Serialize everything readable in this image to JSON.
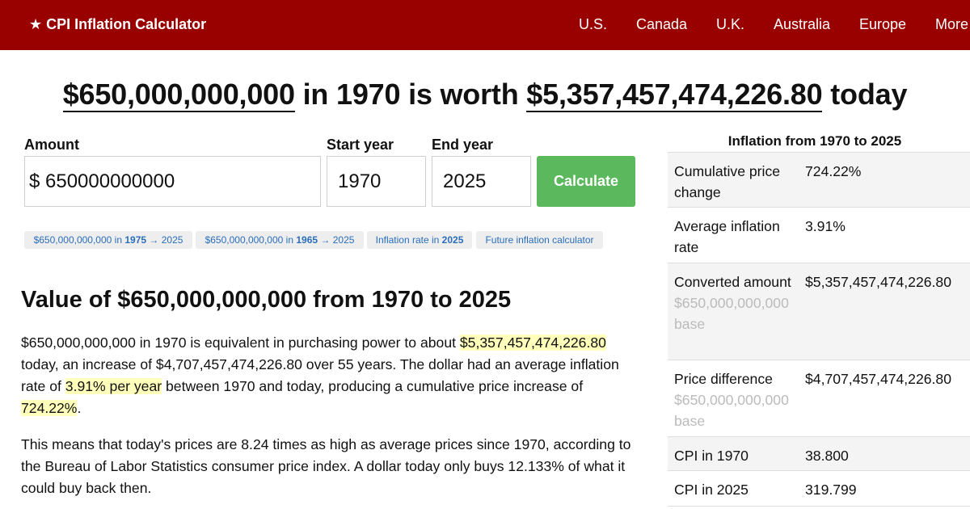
{
  "header": {
    "brand": "★ CPI Inflation Calculator",
    "nav": [
      "U.S.",
      "Canada",
      "U.K.",
      "Australia",
      "Europe",
      "More"
    ]
  },
  "headline": {
    "amount": "$650,000,000,000",
    "mid": " in 1970 is worth ",
    "result": "$5,357,457,474,226.80",
    "end": " today"
  },
  "form": {
    "amount_label": "Amount",
    "amount_value": "$ 650000000000",
    "start_label": "Start year",
    "start_value": "1970",
    "end_label": "End year",
    "end_value": "2025",
    "button": "Calculate"
  },
  "chips": [
    {
      "pre": "$650,000,000,000 in ",
      "bold": "1975",
      "post": " → 2025"
    },
    {
      "pre": "$650,000,000,000 in ",
      "bold": "1965",
      "post": " → 2025"
    },
    {
      "pre": "Inflation rate in ",
      "bold": "2025",
      "post": ""
    },
    {
      "pre": "Future inflation calculator",
      "bold": "",
      "post": ""
    }
  ],
  "article": {
    "title": "Value of $650,000,000,000 from 1970 to 2025",
    "p1": {
      "a": "$650,000,000,000 in 1970 is equivalent in purchasing power to about ",
      "h1": "$5,357,457,474,226.80",
      "b": " today, an increase of $4,707,457,474,226.80 over 55 years. The dollar had an average inflation rate of ",
      "h2": "3.91% per year",
      "c": " between 1970 and today, producing a cumulative price increase of ",
      "h3": "724.22%",
      "d": "."
    },
    "p2": "This means that today's prices are 8.24 times as high as average prices since 1970, according to the Bureau of Labor Statistics consumer price index. A dollar today only buys 12.133% of what it could buy back then."
  },
  "sidebar": {
    "title": "Inflation from 1970 to 2025",
    "rows": [
      {
        "label": "Cumulative price change",
        "sub": "",
        "value": "724.22%"
      },
      {
        "label": "Average inflation rate",
        "sub": "",
        "value": "3.91%"
      },
      {
        "label": "Converted amount",
        "sub": "$650,000,000,000 base",
        "value": "$5,357,457,474,226.80"
      },
      {
        "label": "Price difference",
        "sub": "$650,000,000,000 base",
        "value": "$4,707,457,474,226.80"
      },
      {
        "label": "CPI in 1970",
        "sub": "",
        "value": "38.800"
      },
      {
        "label": "CPI in 2025",
        "sub": "",
        "value": "319.799"
      }
    ]
  }
}
